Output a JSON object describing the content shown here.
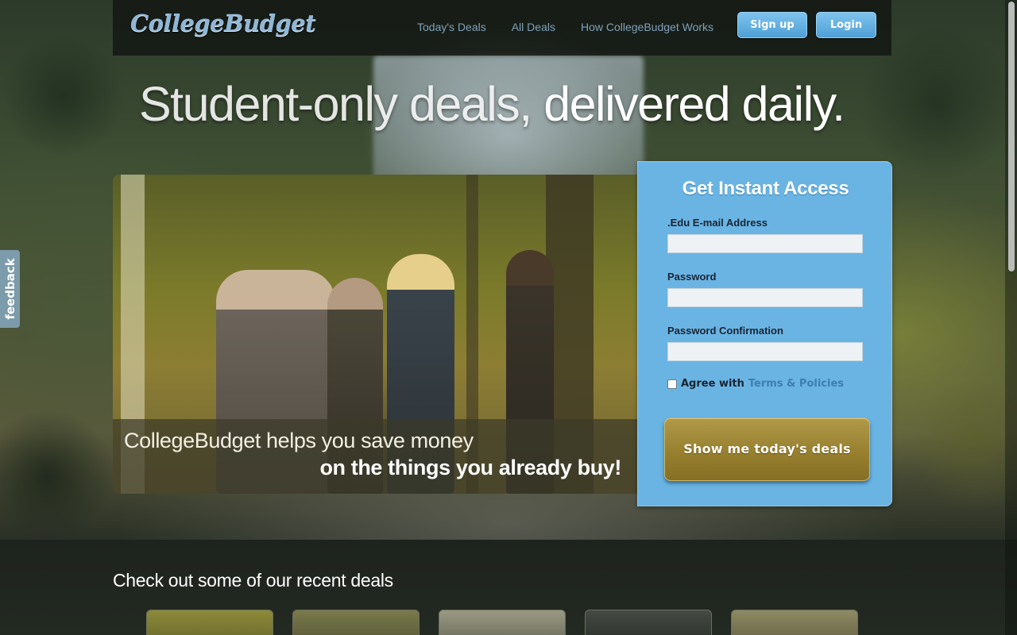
{
  "header": {
    "logo": "CollegeBudget",
    "nav": [
      "Today's Deals",
      "All Deals",
      "How CollegeBudget Works"
    ],
    "signup_label": "Sign up",
    "login_label": "Login"
  },
  "hero": {
    "headline_light": "Student-only deals,",
    "headline_bold": "delivered daily.",
    "caption_line1": "CollegeBudget helps you save money",
    "caption_line2": "on the things you already buy!"
  },
  "form": {
    "title": "Get Instant Access",
    "email_label": ".Edu E-mail Address",
    "email_value": "",
    "password_label": "Password",
    "password_value": "",
    "confirm_label": "Password Confirmation",
    "confirm_value": "",
    "agree_text": "Agree with",
    "terms_link": "Terms & Policies",
    "agree_checked": false,
    "submit_label": "Show me today's deals"
  },
  "feedback_tab": "feedback",
  "recent": {
    "title": "Check out some of our recent deals",
    "deal_count_visible": 5
  },
  "colors": {
    "accent_blue": "#6ab4e4",
    "cta_gold": "#97802f",
    "link_blue": "#3d7fae"
  }
}
